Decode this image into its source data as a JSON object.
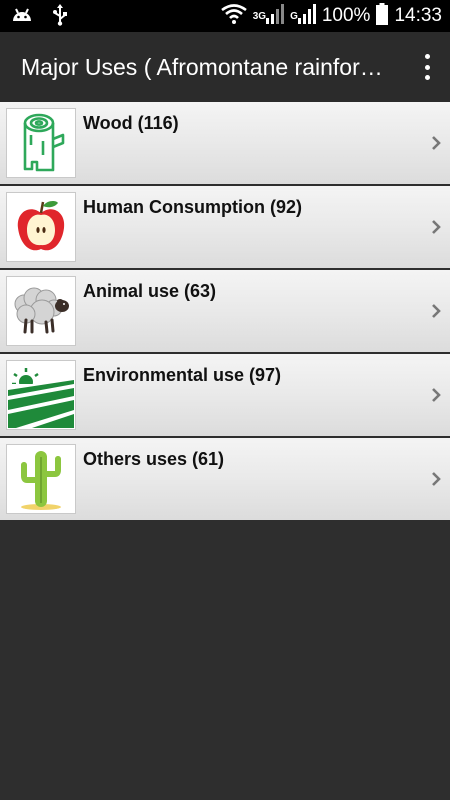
{
  "status_bar": {
    "network_3g": "3G",
    "network_g": "G",
    "battery": "100%",
    "time": "14:33",
    "icons": [
      "android-icon",
      "usb-icon",
      "wifi-icon",
      "signal-icon",
      "signal-icon",
      "battery-icon"
    ]
  },
  "action_bar": {
    "title": "Major Uses ( Afromontane rainforest )",
    "menu_icon": "more-vert-icon"
  },
  "list": {
    "items": [
      {
        "label": "Wood (116)",
        "icon": "wood-log-icon"
      },
      {
        "label": "Human Consumption (92)",
        "icon": "apple-icon"
      },
      {
        "label": "Animal use (63)",
        "icon": "sheep-icon"
      },
      {
        "label": "Environmental use (97)",
        "icon": "field-sun-icon"
      },
      {
        "label": "Others uses (61)",
        "icon": "cactus-icon"
      }
    ]
  },
  "colors": {
    "status_bar_bg": "#000000",
    "action_bar_bg": "#2b2b2b",
    "background": "#2e2e2e",
    "wood_green": "#2ea85a",
    "apple_red": "#e0262b",
    "field_green": "#1f8a3a"
  }
}
